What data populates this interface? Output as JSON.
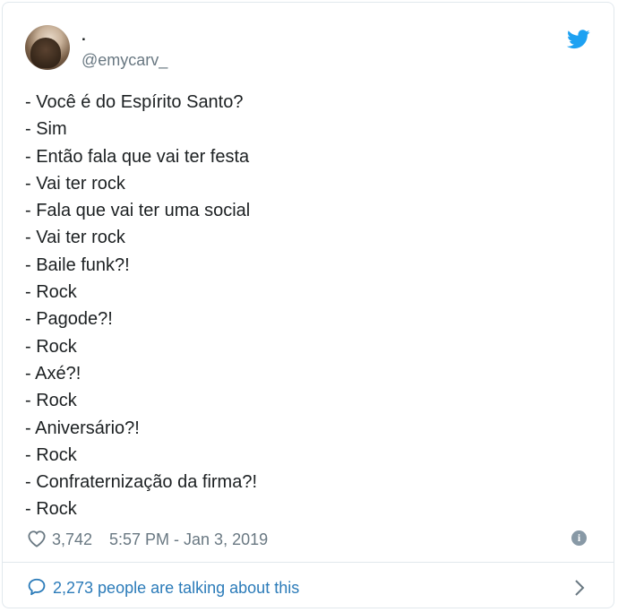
{
  "user": {
    "display_name": ".",
    "handle": "@emycarv_"
  },
  "icons": {
    "brand": "twitter-bird-icon",
    "like": "heart-icon",
    "info": "info-icon",
    "conversation": "speech-bubble-icon",
    "more": "chevron-right-icon"
  },
  "colors": {
    "brand_blue": "#1da1f2",
    "link_blue": "#2b7bb9",
    "secondary_text": "#697882",
    "body_text": "#1c2022"
  },
  "tweet": {
    "lines": [
      "- Você é do Espírito Santo?",
      "- Sim",
      "- Então fala que vai ter festa",
      "- Vai ter rock",
      "- Fala que vai ter uma social",
      "- Vai ter rock",
      "- Baile funk?!",
      "- Rock",
      "- Pagode?!",
      "- Rock",
      "- Axé?!",
      "- Rock",
      "- Aniversário?!",
      "- Rock",
      "- Confraternização da firma?!",
      "- Rock"
    ],
    "likes": "3,742",
    "timestamp": "5:57 PM - Jan 3, 2019",
    "info_glyph": "i"
  },
  "footer": {
    "talking_text": "2,273 people are talking about this"
  }
}
